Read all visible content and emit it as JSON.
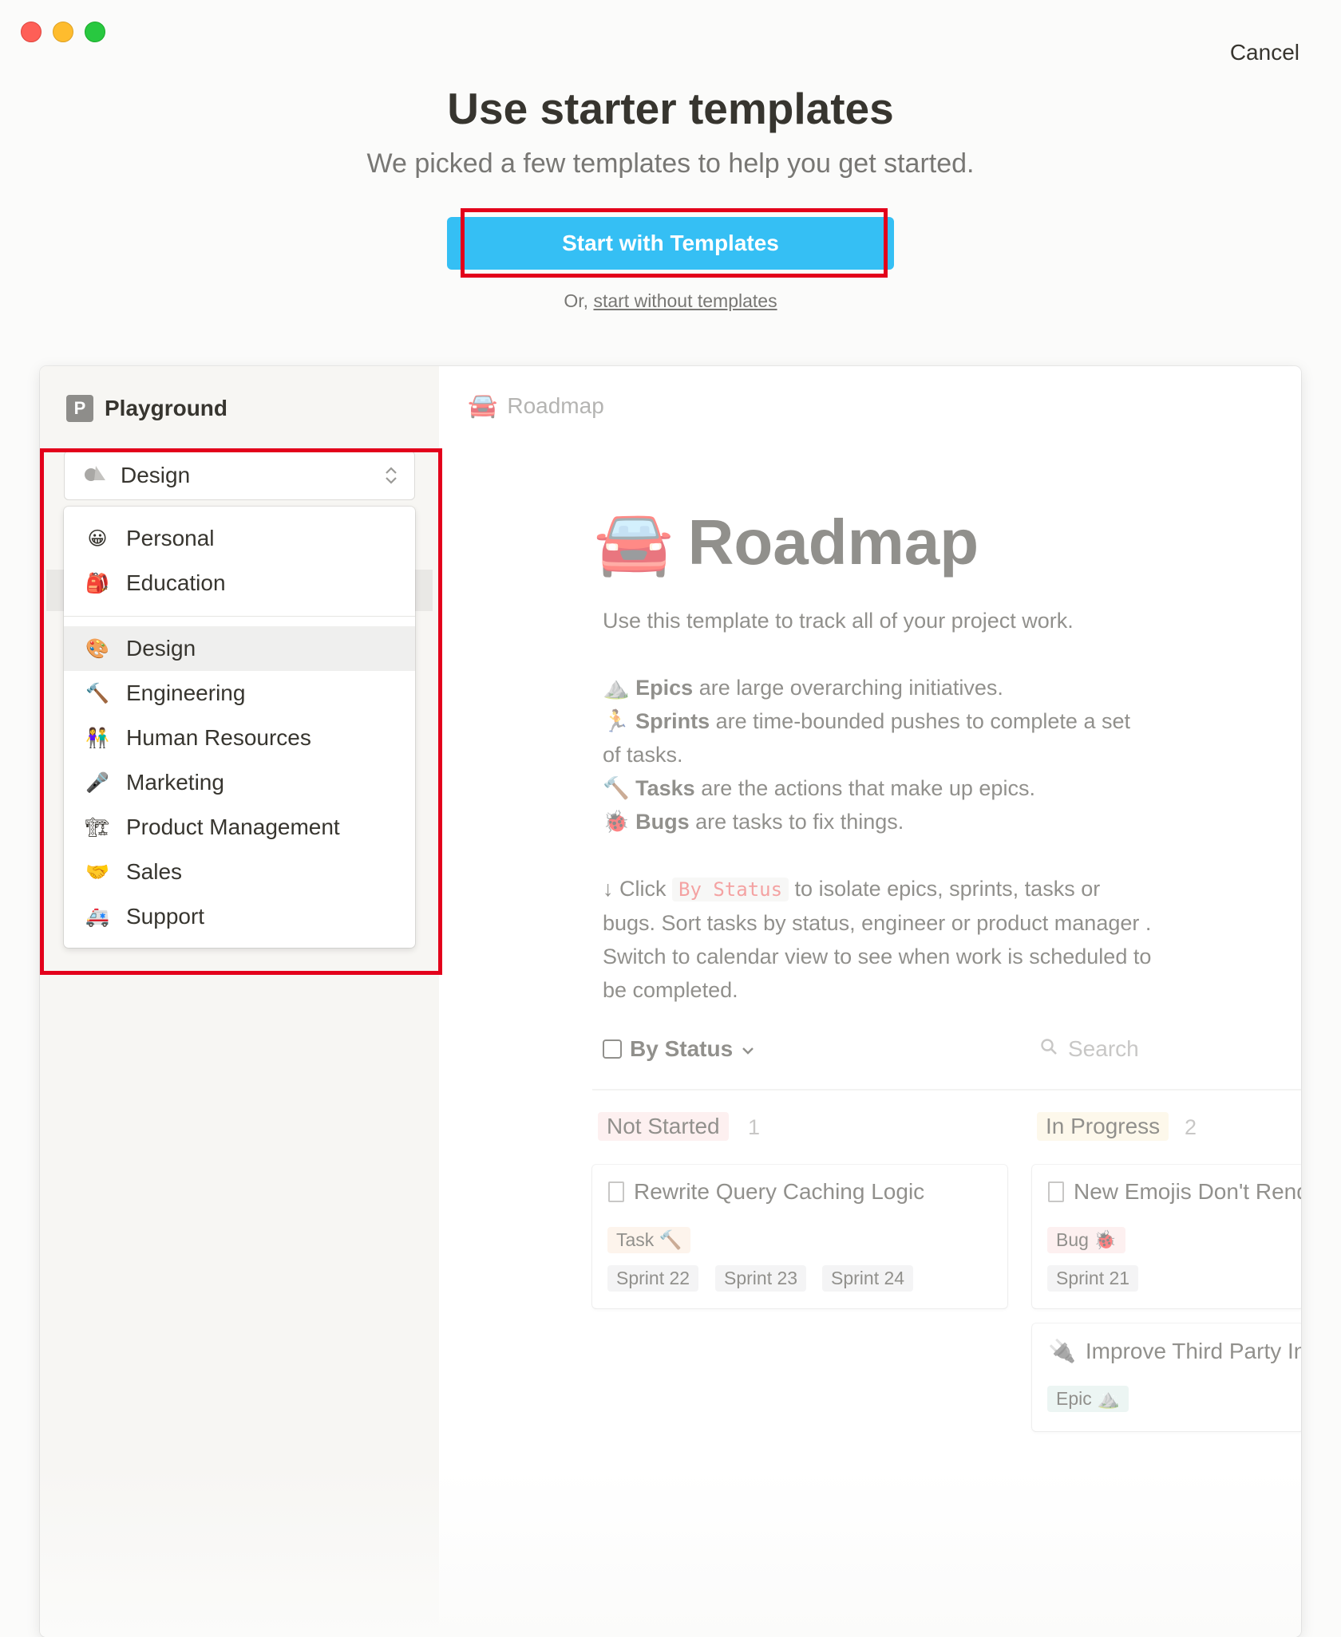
{
  "header": {
    "cancel_label": "Cancel",
    "title": "Use starter templates",
    "subtitle": "We picked a few templates to help you get started.",
    "start_button_label": "Start with Templates",
    "or_prefix": "Or,",
    "start_without_label": "start without templates"
  },
  "colors": {
    "accent": "#35bff4",
    "highlight_border": "#e3001b"
  },
  "preview": {
    "workspace": {
      "badge": "P",
      "name": "Playground"
    },
    "category_select": {
      "icon": "palette-icon",
      "value": "Design"
    },
    "category_menu": {
      "items": [
        {
          "emoji": "😀",
          "label": "Personal"
        },
        {
          "emoji": "🎒",
          "label": "Education"
        },
        {
          "emoji": "🎨",
          "label": "Design",
          "selected": true
        },
        {
          "emoji": "🔨",
          "label": "Engineering"
        },
        {
          "emoji": "👫",
          "label": "Human Resources"
        },
        {
          "emoji": "🎤",
          "label": "Marketing"
        },
        {
          "emoji": "🏗",
          "label": "Product Management"
        },
        {
          "emoji": "🤝",
          "label": "Sales"
        },
        {
          "emoji": "🚑",
          "label": "Support"
        }
      ]
    },
    "page": {
      "breadcrumb_emoji": "🚘",
      "breadcrumb": "Roadmap",
      "title_emoji": "🚘",
      "title": "Roadmap",
      "intro": "Use this template to track all of your project work.",
      "bullets": [
        {
          "emoji": "⛰️",
          "term": "Epics",
          "text": " are large overarching initiatives."
        },
        {
          "emoji": "🏃",
          "term": "Sprints",
          "text": " are time-bounded pushes to complete a set of tasks."
        },
        {
          "emoji": "🔨",
          "term": "Tasks",
          "text": " are the actions that make up epics."
        },
        {
          "emoji": "🐞",
          "term": "Bugs",
          "text": " are tasks to fix things."
        }
      ],
      "click_prefix": "↓ Click ",
      "click_code": "By Status",
      "click_suffix": " to isolate epics, sprints, tasks or bugs. Sort tasks by status, engineer or product manager . Switch to calendar view to see when work is scheduled to be completed.",
      "view_label": "By Status",
      "search_placeholder": "Search",
      "groups": [
        {
          "label": "Not Started",
          "count": "1",
          "color": "#fbe4e4",
          "cards": [
            {
              "title": "Rewrite Query Caching Logic",
              "tags": [
                "Task 🔨",
                "Sprint 22",
                "Sprint 23",
                "Sprint 24"
              ]
            }
          ]
        },
        {
          "label": "In Progress",
          "count": "2",
          "color": "#fbf3db",
          "cards": [
            {
              "title": "New Emojis Don't Render",
              "tags": [
                "Bug 🐞",
                "Sprint 21"
              ]
            },
            {
              "icon_emoji": "🔌",
              "title": "Improve Third Party Integrations",
              "tags": [
                "Epic ⛰️"
              ]
            }
          ]
        }
      ]
    }
  }
}
